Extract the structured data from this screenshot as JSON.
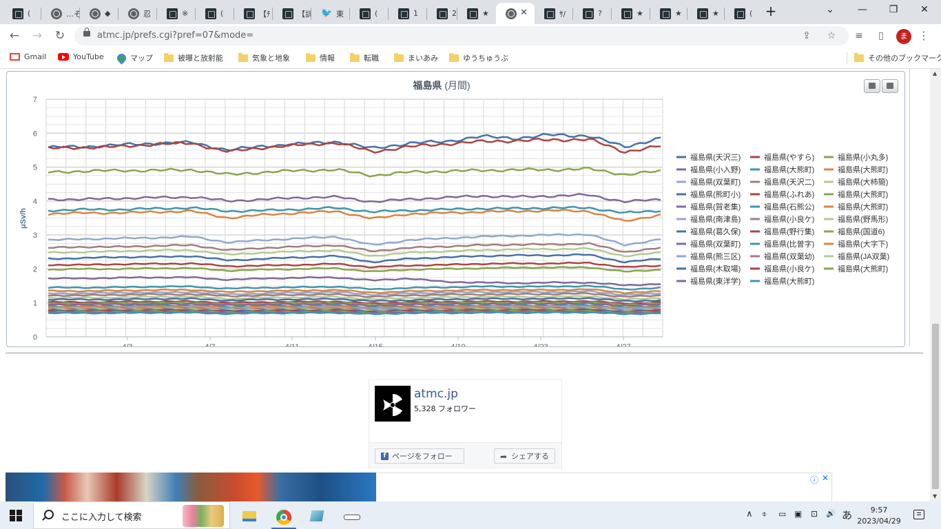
{
  "browser": {
    "tabs": [
      {
        "title": "(",
        "icon": "site-icon"
      },
      {
        "title": "…そ",
        "icon": "globe-icon"
      },
      {
        "title": "◆",
        "icon": "globe-icon"
      },
      {
        "title": "忍",
        "icon": "globe-icon"
      },
      {
        "title": "※",
        "icon": "site-icon"
      },
      {
        "title": "(",
        "icon": "site-icon"
      },
      {
        "title": "【ﾁ",
        "icon": "site-icon"
      },
      {
        "title": "【訓",
        "icon": "site-icon"
      },
      {
        "title": "東",
        "icon": "twitter-icon"
      },
      {
        "title": "(",
        "icon": "site-icon"
      },
      {
        "title": "1",
        "icon": "site-icon"
      },
      {
        "title": "2",
        "icon": "site-icon"
      },
      {
        "title": "★",
        "icon": "site-icon"
      },
      {
        "title": "",
        "icon": "globe-icon",
        "active": true
      },
      {
        "title": "ｻ/",
        "icon": "site-icon"
      },
      {
        "title": "?",
        "icon": "site-icon"
      },
      {
        "title": "★",
        "icon": "site-icon"
      },
      {
        "title": "★",
        "icon": "site-icon"
      },
      {
        "title": "★",
        "icon": "site-icon"
      },
      {
        "title": "(",
        "icon": "site-icon"
      }
    ],
    "new_tab_glyph": "+",
    "tab_close_glyph": "✕",
    "window_controls": {
      "dropdown": "⌄",
      "minimize": "—",
      "restore": "❐",
      "close": "✕"
    },
    "url": "atmc.jp/prefs.cgi?pref=07&mode=",
    "profile_initial": "ま",
    "nav": {
      "back": "←",
      "forward": "→",
      "reload": "↻"
    },
    "toolbar_icons": {
      "share": "⇪",
      "bookmark_star": "☆",
      "media": "≡",
      "sidepanel": "▯",
      "menu": "⋮"
    }
  },
  "bookmarks": {
    "items": [
      {
        "label": "Gmail",
        "icon": "gmail-icon"
      },
      {
        "label": "YouTube",
        "icon": "youtube-icon"
      },
      {
        "label": "マップ",
        "icon": "maps-icon"
      },
      {
        "label": "被曝と放射能",
        "icon": "folder-icon"
      },
      {
        "label": "気象と地象",
        "icon": "folder-icon"
      },
      {
        "label": "情報",
        "icon": "folder-icon"
      },
      {
        "label": "転職",
        "icon": "folder-icon"
      },
      {
        "label": "まいあみ",
        "icon": "folder-icon"
      },
      {
        "label": "ゆうちゅうぶ",
        "icon": "folder-icon"
      }
    ],
    "other": "その他のブックマーク"
  },
  "chart_data": {
    "type": "line",
    "title": "福島県",
    "subtitle": "(月間)",
    "xlabel": "",
    "ylabel": "μSv/h",
    "ylim": [
      0,
      7
    ],
    "yticks": [
      "0",
      "1",
      "2",
      "3",
      "4",
      "5",
      "6",
      "7"
    ],
    "xticks": [
      "4/3",
      "4/7",
      "4/11",
      "4/15",
      "4/19",
      "4/23",
      "4/27"
    ],
    "grid": true,
    "legend_position": "right",
    "series": [
      {
        "name": "福島県(天沢三)",
        "color": "#4572a7",
        "values": [
          5.58,
          5.6,
          5.65,
          5.7,
          5.72,
          5.5,
          5.62,
          5.68,
          5.75,
          5.55,
          5.7,
          5.75,
          5.9,
          5.85,
          5.95,
          5.92,
          5.6,
          5.85
        ]
      },
      {
        "name": "福島県(やすら)",
        "color": "#aa4643",
        "values": [
          5.55,
          5.58,
          5.6,
          5.68,
          5.7,
          5.45,
          5.58,
          5.65,
          5.72,
          5.45,
          5.6,
          5.68,
          5.75,
          5.78,
          5.8,
          5.82,
          5.45,
          5.62
        ]
      },
      {
        "name": "福島県(小丸多)",
        "color": "#89a54e",
        "values": [
          4.85,
          4.88,
          4.9,
          4.9,
          4.92,
          4.78,
          4.85,
          4.9,
          4.92,
          4.75,
          4.85,
          4.88,
          4.9,
          4.92,
          4.92,
          4.95,
          4.78,
          4.88
        ]
      },
      {
        "name": "福島県(小入野)",
        "color": "#80699b",
        "values": [
          4.05,
          4.05,
          4.08,
          4.1,
          4.12,
          4.0,
          4.05,
          4.1,
          4.12,
          3.98,
          4.05,
          4.1,
          4.15,
          4.12,
          4.15,
          4.18,
          3.98,
          4.05
        ]
      },
      {
        "name": "福島県(大熊町)",
        "color": "#3d96ae",
        "values": [
          3.72,
          3.75,
          3.75,
          3.78,
          3.8,
          3.7,
          3.72,
          3.76,
          3.8,
          3.68,
          3.72,
          3.75,
          3.78,
          3.78,
          3.8,
          3.8,
          3.65,
          3.72
        ]
      },
      {
        "name": "福島県(大熊町)",
        "color": "#db843d",
        "values": [
          3.62,
          3.65,
          3.65,
          3.68,
          3.7,
          3.5,
          3.6,
          3.65,
          3.7,
          3.48,
          3.62,
          3.65,
          3.68,
          3.7,
          3.72,
          3.7,
          3.4,
          3.6
        ]
      },
      {
        "name": "福島県(双葉町)",
        "color": "#92a8cd",
        "values": [
          2.85,
          2.88,
          2.9,
          2.92,
          2.95,
          2.78,
          2.85,
          2.9,
          2.95,
          2.7,
          2.85,
          2.9,
          2.95,
          2.98,
          3.0,
          3.02,
          2.7,
          2.88
        ]
      },
      {
        "name": "福島県(天沢二)",
        "color": "#a47d7c",
        "values": [
          2.62,
          2.65,
          2.65,
          2.68,
          2.7,
          2.55,
          2.62,
          2.66,
          2.7,
          2.52,
          2.62,
          2.66,
          2.7,
          2.72,
          2.72,
          2.75,
          2.5,
          2.62
        ]
      },
      {
        "name": "福島県(大柿簡)",
        "color": "#b5ca92",
        "values": [
          2.48,
          2.5,
          2.52,
          2.55,
          2.55,
          2.42,
          2.48,
          2.52,
          2.55,
          2.38,
          2.48,
          2.52,
          2.55,
          2.58,
          2.58,
          2.6,
          2.38,
          2.48
        ]
      },
      {
        "name": "福島県(熊町小)",
        "color": "#4572a7",
        "values": [
          2.3,
          2.32,
          2.35,
          2.35,
          2.38,
          2.25,
          2.3,
          2.34,
          2.38,
          2.2,
          2.3,
          2.34,
          2.38,
          2.4,
          2.4,
          2.42,
          2.2,
          2.3
        ]
      },
      {
        "name": "福島県(ふれあ)",
        "color": "#aa4643",
        "values": [
          2.12,
          2.12,
          2.14,
          2.15,
          2.16,
          2.08,
          2.1,
          2.12,
          2.15,
          2.05,
          2.1,
          2.12,
          2.15,
          2.16,
          2.16,
          2.18,
          2.05,
          2.1
        ]
      },
      {
        "name": "福島県(大熊町)",
        "color": "#89a54e",
        "values": [
          1.98,
          2.0,
          2.0,
          2.02,
          2.02,
          1.95,
          1.98,
          2.0,
          2.02,
          1.92,
          1.98,
          2.0,
          2.02,
          2.04,
          2.04,
          2.05,
          1.92,
          1.98
        ]
      },
      {
        "name": "福島県(賀老集)",
        "color": "#80699b",
        "values": [
          1.72,
          1.72,
          1.74,
          1.75,
          1.75,
          1.68,
          1.72,
          1.74,
          1.75,
          1.66,
          1.72,
          1.62,
          1.6,
          1.58,
          1.6,
          1.6,
          1.52,
          1.56
        ]
      },
      {
        "name": "福島県(石熊公)",
        "color": "#3d96ae",
        "values": [
          1.45,
          1.45,
          1.46,
          1.48,
          1.48,
          1.42,
          1.45,
          1.46,
          1.48,
          1.4,
          1.44,
          1.46,
          1.48,
          1.48,
          1.48,
          1.5,
          1.4,
          1.44
        ]
      },
      {
        "name": "福島県(大熊町)",
        "color": "#db843d",
        "values": [
          1.35,
          1.35,
          1.36,
          1.38,
          1.38,
          1.32,
          1.35,
          1.36,
          1.38,
          1.3,
          1.34,
          1.36,
          1.38,
          1.38,
          1.38,
          1.4,
          1.3,
          1.34
        ]
      },
      {
        "name": "福島県(南津島)",
        "color": "#92a8cd",
        "values": [
          1.28,
          1.28,
          1.3,
          1.3,
          1.32,
          1.25,
          1.28,
          1.3,
          1.32,
          1.24,
          1.28,
          1.3,
          1.32,
          1.32,
          1.32,
          1.34,
          1.24,
          1.28
        ]
      },
      {
        "name": "福島県(小良ケ)",
        "color": "#a47d7c",
        "values": [
          1.22,
          1.22,
          1.24,
          1.25,
          1.25,
          1.2,
          1.22,
          1.24,
          1.25,
          1.18,
          1.22,
          1.24,
          1.25,
          1.26,
          1.26,
          1.28,
          1.18,
          1.22
        ]
      },
      {
        "name": "福島県(野馬形)",
        "color": "#b5ca92",
        "values": [
          1.15,
          1.15,
          1.16,
          1.18,
          1.18,
          1.12,
          1.15,
          1.16,
          1.18,
          1.1,
          1.15,
          1.16,
          1.18,
          1.18,
          1.18,
          1.2,
          1.1,
          1.15
        ]
      },
      {
        "name": "福島県(葛久保)",
        "color": "#4572a7",
        "values": [
          1.1,
          1.1,
          1.1,
          1.12,
          1.12,
          1.07,
          1.1,
          1.1,
          1.12,
          1.05,
          1.08,
          1.1,
          1.12,
          1.12,
          1.12,
          1.14,
          1.05,
          1.08
        ]
      },
      {
        "name": "福島県(野行集)",
        "color": "#aa4643",
        "values": [
          1.02,
          1.02,
          1.03,
          1.04,
          1.04,
          1.0,
          1.02,
          1.03,
          1.04,
          0.98,
          1.02,
          1.03,
          1.04,
          1.04,
          1.04,
          1.05,
          0.98,
          1.02
        ]
      },
      {
        "name": "福島県(国道6)",
        "color": "#89a54e",
        "values": [
          0.98,
          0.98,
          0.99,
          1.0,
          1.0,
          0.96,
          0.98,
          0.99,
          1.0,
          0.95,
          0.98,
          0.99,
          1.0,
          1.0,
          1.0,
          1.01,
          0.95,
          0.98
        ]
      },
      {
        "name": "福島県(双葉町)",
        "color": "#80699b",
        "values": [
          0.95,
          0.95,
          0.96,
          0.96,
          0.97,
          0.93,
          0.95,
          0.96,
          0.97,
          0.92,
          0.95,
          0.96,
          0.97,
          0.97,
          0.97,
          0.98,
          0.92,
          0.95
        ]
      },
      {
        "name": "福島県(比曽字)",
        "color": "#3d96ae",
        "values": [
          0.9,
          0.9,
          0.91,
          0.92,
          0.92,
          0.88,
          0.9,
          0.91,
          0.92,
          0.87,
          0.9,
          0.91,
          0.92,
          0.92,
          0.92,
          0.93,
          0.87,
          0.9
        ]
      },
      {
        "name": "福島県(大字下)",
        "color": "#db843d",
        "values": [
          0.88,
          0.88,
          0.88,
          0.89,
          0.9,
          0.86,
          0.88,
          0.88,
          0.9,
          0.85,
          0.88,
          0.88,
          0.9,
          0.9,
          0.9,
          0.9,
          0.85,
          0.88
        ]
      },
      {
        "name": "福島県(熊三区)",
        "color": "#92a8cd",
        "values": [
          0.85,
          0.85,
          0.86,
          0.86,
          0.87,
          0.83,
          0.85,
          0.86,
          0.87,
          0.82,
          0.85,
          0.86,
          0.87,
          0.87,
          0.87,
          0.88,
          0.82,
          0.85
        ]
      },
      {
        "name": "福島県(双葉幼)",
        "color": "#a47d7c",
        "values": [
          0.82,
          0.82,
          0.83,
          0.83,
          0.84,
          0.8,
          0.82,
          0.83,
          0.84,
          0.79,
          0.82,
          0.83,
          0.84,
          0.84,
          0.84,
          0.85,
          0.79,
          0.82
        ]
      },
      {
        "name": "福島県(JA双葉)",
        "color": "#b5ca92",
        "values": [
          0.8,
          0.8,
          0.8,
          0.81,
          0.81,
          0.78,
          0.8,
          0.8,
          0.81,
          0.77,
          0.8,
          0.8,
          0.81,
          0.81,
          0.81,
          0.82,
          0.77,
          0.8
        ]
      },
      {
        "name": "福島県(木取場)",
        "color": "#4572a7",
        "values": [
          0.78,
          0.78,
          0.78,
          0.79,
          0.79,
          0.76,
          0.78,
          0.78,
          0.79,
          0.75,
          0.78,
          0.78,
          0.79,
          0.79,
          0.79,
          0.8,
          0.75,
          0.78
        ]
      },
      {
        "name": "福島県(小良ケ)",
        "color": "#aa4643",
        "values": [
          0.76,
          0.76,
          0.76,
          0.77,
          0.77,
          0.74,
          0.76,
          0.76,
          0.77,
          0.73,
          0.76,
          0.76,
          0.77,
          0.77,
          0.77,
          0.78,
          0.73,
          0.76
        ]
      },
      {
        "name": "福島県(大熊町)",
        "color": "#89a54e",
        "values": [
          0.74,
          0.74,
          0.74,
          0.75,
          0.75,
          0.72,
          0.74,
          0.74,
          0.75,
          0.71,
          0.74,
          0.74,
          0.75,
          0.75,
          0.75,
          0.76,
          0.71,
          0.74
        ]
      },
      {
        "name": "福島県(東洋学)",
        "color": "#80699b",
        "values": [
          0.72,
          0.72,
          0.72,
          0.73,
          0.73,
          0.7,
          0.72,
          0.72,
          0.73,
          0.69,
          0.72,
          0.72,
          0.73,
          0.73,
          0.73,
          0.74,
          0.69,
          0.72
        ]
      },
      {
        "name": "福島県(大熊町)",
        "color": "#3d96ae",
        "values": [
          0.7,
          0.7,
          0.7,
          0.71,
          0.71,
          0.68,
          0.7,
          0.7,
          0.71,
          0.67,
          0.7,
          0.7,
          0.71,
          0.71,
          0.71,
          0.72,
          0.67,
          0.7
        ]
      }
    ]
  },
  "fb_widget": {
    "name": "atmc.jp",
    "followers": "5,328 フォロワー",
    "follow_label": "ページをフォロー",
    "share_label": "シェアする",
    "logo_icon": "radiation-icon"
  },
  "ad": {
    "info_glyph": "ⓘ",
    "close_glyph": "✕"
  },
  "taskbar": {
    "search_placeholder": "ここに入力して検索",
    "tray_ime": "あ",
    "tray_caret": "∧",
    "tray_volume": "🔊",
    "time": "9:57",
    "date": "2023/04/29"
  }
}
